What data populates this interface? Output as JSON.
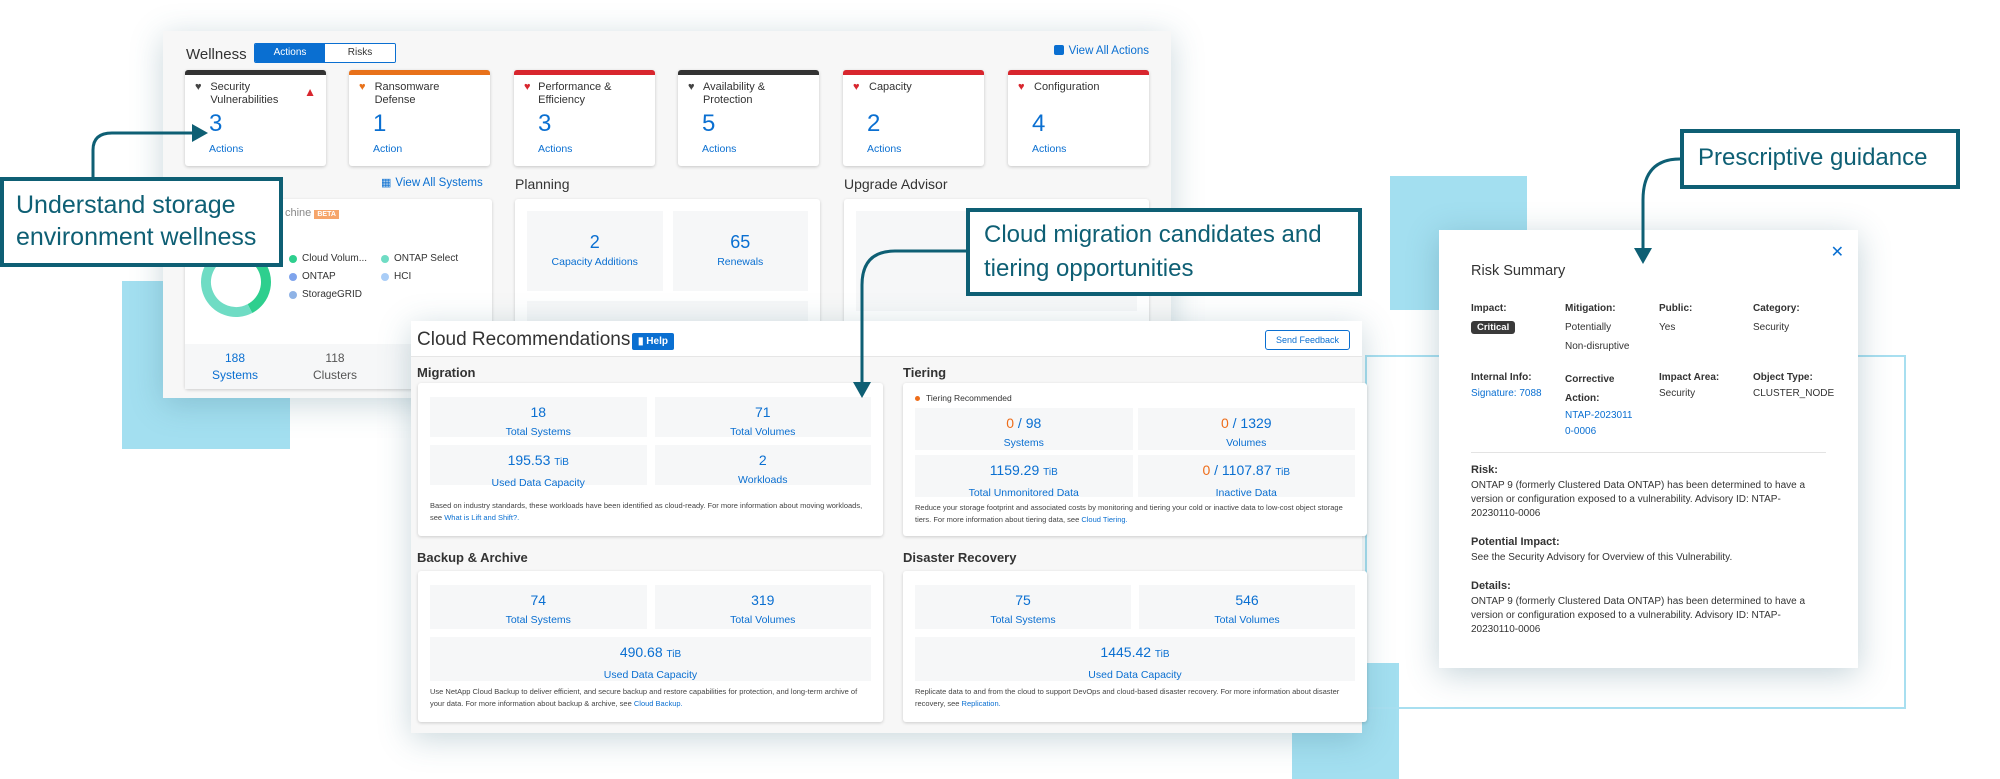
{
  "callouts": {
    "wellness": "Understand storage environment wellness",
    "cloud": "Cloud migration candidates and tiering opportunities",
    "guidance": "Prescriptive guidance"
  },
  "colors": {
    "accent": "#0a6fd1",
    "callout": "#0e5f74",
    "decor": "#a3dff0",
    "warning": "#ee6d1a",
    "critical": "#d8262e"
  },
  "wellness": {
    "title": "Wellness",
    "tabs": [
      {
        "label": "Actions",
        "active": true
      },
      {
        "label": "Risks",
        "active": false
      }
    ],
    "view_all_actions": "View All Actions",
    "cards": [
      {
        "title": "Security Vulnerabilities",
        "count": "3",
        "label": "Actions",
        "bar": "#333333",
        "icon": "heart-monitor-icon",
        "icon_color": "#444444",
        "warning": true
      },
      {
        "title": "Ransomware Defense",
        "count": "1",
        "label": "Action",
        "bar": "#e8711a",
        "icon": "heart-monitor-icon",
        "icon_color": "#e8711a"
      },
      {
        "title": "Performance & Efficiency",
        "count": "3",
        "label": "Actions",
        "bar": "#d8262e",
        "icon": "heart-monitor-icon",
        "icon_color": "#d8262e"
      },
      {
        "title": "Availability & Protection",
        "count": "5",
        "label": "Actions",
        "bar": "#333333",
        "icon": "heart-monitor-icon",
        "icon_color": "#444444"
      },
      {
        "title": "Capacity",
        "count": "2",
        "label": "Actions",
        "bar": "#d8262e",
        "icon": "heart-monitor-icon",
        "icon_color": "#d8262e"
      },
      {
        "title": "Configuration",
        "count": "4",
        "label": "Actions",
        "bar": "#d8262e",
        "icon": "heart-monitor-icon",
        "icon_color": "#d8262e"
      }
    ],
    "view_all_systems": "View All Systems",
    "systems_card": {
      "title": "chine",
      "badge": "BETA",
      "legend": [
        {
          "label": "Cloud Volum...",
          "color": "#2ecf8e"
        },
        {
          "label": "ONTAP Select",
          "color": "#6fdcc4"
        },
        {
          "label": "ONTAP",
          "color": "#7fa4ec"
        },
        {
          "label": "HCI",
          "color": "#a9cdf7"
        },
        {
          "label": "StorageGRID",
          "color": "#8fb3e6"
        }
      ],
      "donut": [
        {
          "label": "Cloud Volum...",
          "share": 28
        },
        {
          "label": "ONTAP Select",
          "share": 52
        },
        {
          "label": "ONTAP",
          "share": 12
        },
        {
          "label": "StorageGRID",
          "share": 8
        }
      ],
      "stats": [
        {
          "value": "188",
          "label": "Systems",
          "link": true
        },
        {
          "value": "118",
          "label": "Clusters",
          "link": false
        }
      ]
    },
    "planning": {
      "title": "Planning",
      "tiles": [
        {
          "value": "2",
          "label": "Capacity Additions"
        },
        {
          "value": "65",
          "label": "Renewals"
        }
      ]
    },
    "upgrade": {
      "title": "Upgrade Advisor"
    }
  },
  "cloud": {
    "title": "Cloud Recommendations",
    "help": "Help",
    "feedback": "Send Feedback",
    "migration": {
      "title": "Migration",
      "tiles": [
        {
          "value": "18",
          "label": "Total Systems"
        },
        {
          "value": "71",
          "label": "Total Volumes"
        },
        {
          "value": "195.53",
          "unit": "TiB",
          "label": "Used Data Capacity"
        },
        {
          "value": "2",
          "label": "Workloads"
        }
      ],
      "note": "Based on industry standards, these workloads have been identified as cloud-ready. For more information about moving workloads, see ",
      "link": "What is Lift and Shift?."
    },
    "tiering": {
      "title": "Tiering",
      "legend": "Tiering Recommended",
      "tiles": [
        {
          "hi": "0",
          "value": "98",
          "label": "Systems"
        },
        {
          "hi": "0",
          "value": "1329",
          "label": "Volumes"
        },
        {
          "value": "1159.29",
          "unit": "TiB",
          "label": "Total Unmonitored Data"
        },
        {
          "hi": "0",
          "value": "1107.87",
          "unit": "TiB",
          "label": "Inactive Data"
        }
      ],
      "note": "Reduce your storage footprint and associated costs by monitoring and tiering your cold or inactive data to low-cost object storage tiers. For more information about tiering data, see ",
      "link": "Cloud Tiering."
    },
    "backup": {
      "title": "Backup & Archive",
      "tiles": [
        {
          "value": "74",
          "label": "Total Systems"
        },
        {
          "value": "319",
          "label": "Total Volumes"
        },
        {
          "value": "490.68",
          "unit": "TiB",
          "label": "Used Data Capacity"
        }
      ],
      "note": "Use NetApp Cloud Backup to deliver efficient, and secure backup and restore capabilities for protection, and long-term archive of your data. For more information about backup & archive, see ",
      "link": "Cloud Backup."
    },
    "dr": {
      "title": "Disaster Recovery",
      "tiles": [
        {
          "value": "75",
          "label": "Total Systems"
        },
        {
          "value": "546",
          "label": "Total Volumes"
        },
        {
          "value": "1445.42",
          "unit": "TiB",
          "label": "Used Data Capacity"
        }
      ],
      "note": "Replicate data to and from the cloud to support DevOps and cloud-based disaster recovery. For more information about disaster recovery, see ",
      "link": "Replication."
    }
  },
  "risk": {
    "title": "Risk Summary",
    "impact_label": "Impact:",
    "impact": "Critical",
    "mitigation_label": "Mitigation:",
    "mitigation": "Potentially Non-disruptive",
    "public_label": "Public:",
    "public": "Yes",
    "category_label": "Category:",
    "category": "Security",
    "internal_label": "Internal Info:",
    "internal": "Signature: 7088",
    "corrective_label": "Corrective Action:",
    "corrective": "NTAP-20230110-0006",
    "area_label": "Impact Area:",
    "area": "Security",
    "object_label": "Object Type:",
    "object": "CLUSTER_NODE",
    "risk_label": "Risk:",
    "risk_text": "ONTAP 9 (formerly Clustered Data ONTAP) has been determined to have a version or configuration exposed to a vulnerability. Advisory ID: NTAP-20230110-0006",
    "potential_label": "Potential Impact:",
    "potential_text": "See the Security Advisory for Overview of this Vulnerability.",
    "details_label": "Details:",
    "details_text": "ONTAP 9 (formerly Clustered Data ONTAP) has been determined to have a version or configuration exposed to a vulnerability. Advisory ID: NTAP-20230110-0006"
  }
}
